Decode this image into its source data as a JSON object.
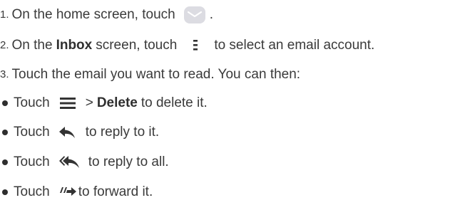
{
  "steps": [
    {
      "num": "1.",
      "pre": "On the home screen, touch",
      "post": "."
    },
    {
      "num": "2.",
      "pre": "On the",
      "bold": "Inbox",
      "mid": "screen, touch",
      "post": "to select an email account."
    },
    {
      "num": "3.",
      "text": "Touch the email you want to read. You can then:"
    }
  ],
  "bullets": [
    {
      "pre": "Touch",
      "sep": ">",
      "bold": "Delete",
      "post": "to delete it.",
      "icon": "menu-lines-icon"
    },
    {
      "pre": "Touch",
      "post": "to reply to it.",
      "icon": "reply-arrow-icon"
    },
    {
      "pre": "Touch",
      "post": "to reply to all.",
      "icon": "reply-all-arrow-icon"
    },
    {
      "pre": "Touch",
      "post": "to forward it.",
      "icon": "forward-arrow-icon"
    }
  ],
  "icons": {
    "step1": "email-app-icon",
    "step2": "menu-dots-icon"
  },
  "colors": {
    "text": "#3a3a3a",
    "icon_light": "#dcdce2",
    "icon_dark": "#333333"
  }
}
